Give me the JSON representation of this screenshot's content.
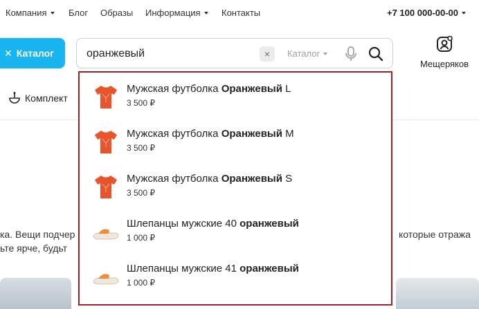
{
  "topnav": {
    "items": [
      {
        "label": "Компания",
        "dropdown": true
      },
      {
        "label": "Блог",
        "dropdown": false
      },
      {
        "label": "Образы",
        "dropdown": false
      },
      {
        "label": "Информация",
        "dropdown": true
      },
      {
        "label": "Контакты",
        "dropdown": false
      }
    ],
    "phone": "+7 100 000-00-00"
  },
  "header": {
    "catalog_button": "Каталог",
    "search": {
      "query": "оранжевый",
      "clear": "×",
      "scope": "Каталог"
    },
    "user": {
      "name": "Мещеряков"
    }
  },
  "subnav": {
    "komplekt": "Комплект"
  },
  "background": {
    "line1_left": "ка. Вещи подчер",
    "line1_right": "которые отража",
    "line2_left": "ьте ярче, будьт"
  },
  "suggestions": [
    {
      "prefix": "Мужская футболка ",
      "bold": "Оранжевый",
      "suffix": " L",
      "price": "3 500 ₽",
      "icon": "tshirt-icon"
    },
    {
      "prefix": "Мужская футболка ",
      "bold": "Оранжевый",
      "suffix": " M",
      "price": "3 500 ₽",
      "icon": "tshirt-icon"
    },
    {
      "prefix": "Мужская футболка ",
      "bold": "Оранжевый",
      "suffix": " S",
      "price": "3 500 ₽",
      "icon": "tshirt-icon"
    },
    {
      "prefix": "Шлепанцы мужские 40 ",
      "bold": "оранжевый",
      "suffix": "",
      "price": "1 000 ₽",
      "icon": "slipper-icon"
    },
    {
      "prefix": "Шлепанцы мужские 41 ",
      "bold": "оранжевый",
      "suffix": "",
      "price": "1 000 ₽",
      "icon": "slipper-icon"
    }
  ],
  "colors": {
    "accent": "#19b5f1",
    "highlight_border": "#a32020",
    "product": "#e8552c"
  }
}
